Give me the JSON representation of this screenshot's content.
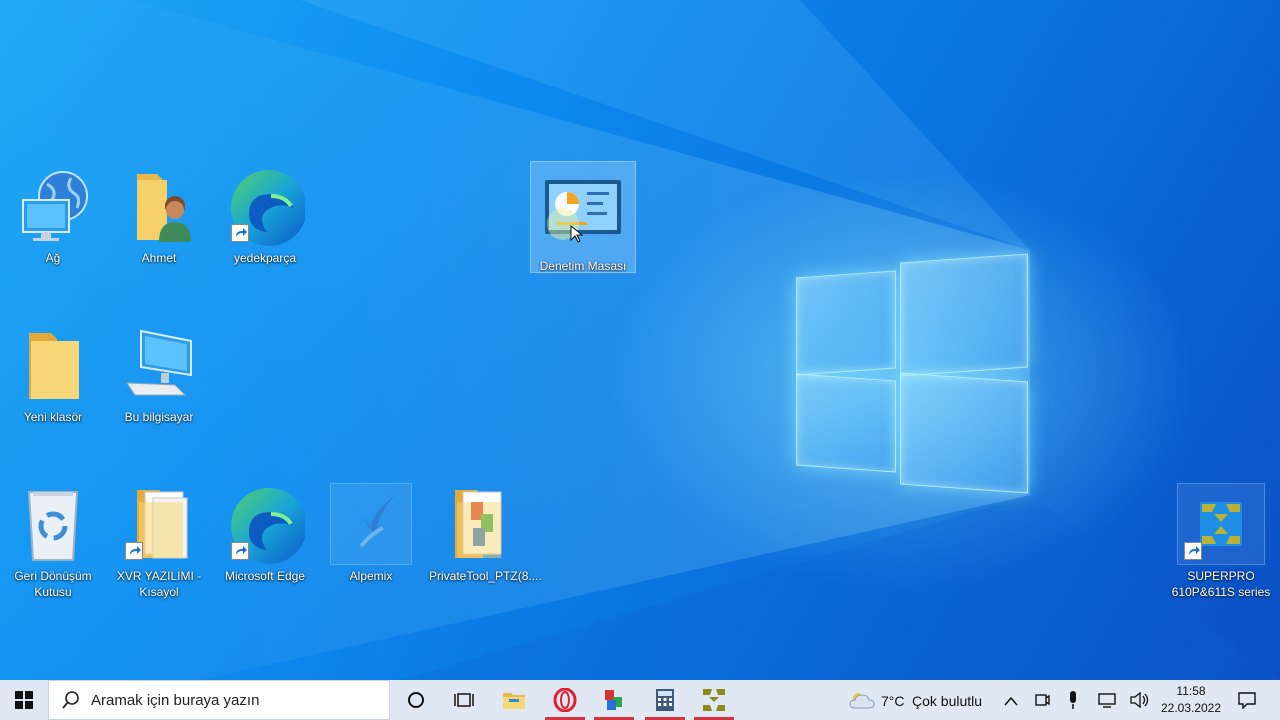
{
  "desktop": {
    "icons": [
      {
        "label": "Ağ",
        "icon": "network-globe-icon"
      },
      {
        "label": "Ahmet",
        "icon": "user-folder-icon"
      },
      {
        "label": "yedekparça",
        "icon": "edge-icon"
      },
      {
        "label": "Denetim Masası",
        "icon": "control-panel-icon"
      },
      {
        "label": "Yeni klasör",
        "icon": "folder-icon"
      },
      {
        "label": "Bu bilgisayar",
        "icon": "computer-icon"
      },
      {
        "label": "Geri Dönüşüm Kutusu",
        "icon": "recycle-bin-icon"
      },
      {
        "label": "XVR YAZILIMI - Kısayol",
        "icon": "folder-docs-icon"
      },
      {
        "label": "Microsoft Edge",
        "icon": "edge-icon"
      },
      {
        "label": "Alpemix",
        "icon": "alpemix-icon"
      },
      {
        "label": "PrivateTool_PTZ(8....",
        "icon": "folder-apps-icon"
      },
      {
        "label": "SUPERPRO 610P&611S series",
        "icon": "superpro-icon"
      }
    ]
  },
  "taskbar": {
    "search_placeholder": "Aramak için buraya yazın",
    "weather_temp": "7°C",
    "weather_desc": "Çok bulutlu",
    "time": "11:58",
    "date": "22.03.2022"
  },
  "colors": {
    "taskbar_bg": "#dfe8f3",
    "active_indicator": "#d4343f",
    "wallpaper_blue": "#0a7fe0"
  }
}
